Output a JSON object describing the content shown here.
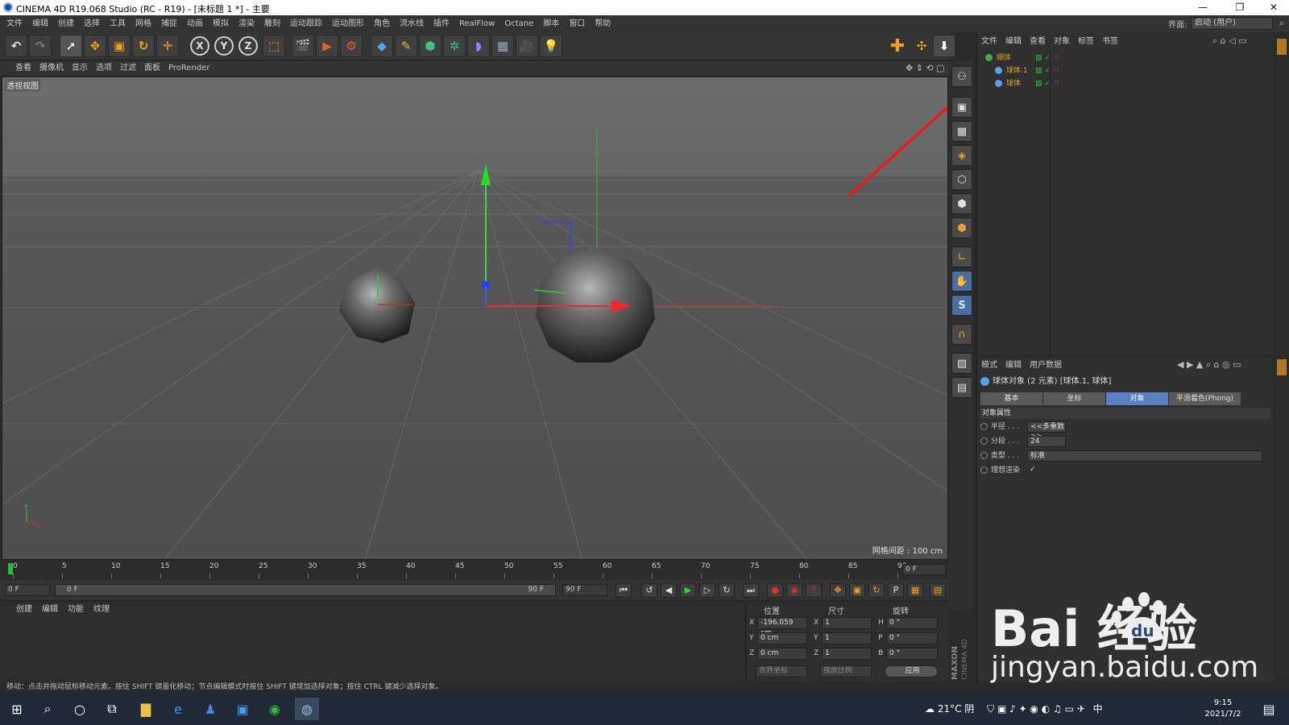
{
  "titlebar": {
    "title": "CINEMA 4D R19.068 Studio (RC - R19) - [未标题 1 *] - 主要",
    "minimize": "—",
    "maximize": "❐",
    "close": "✕"
  },
  "menubar": {
    "items": [
      "文件",
      "编辑",
      "创建",
      "选择",
      "工具",
      "网格",
      "捕捉",
      "动画",
      "模拟",
      "渲染",
      "雕刻",
      "运动跟踪",
      "运动图形",
      "角色",
      "流水线",
      "插件",
      "RealFlow",
      "Octane",
      "脚本",
      "窗口",
      "帮助"
    ],
    "layout_label": "界面:",
    "layout_value": "启动 (用户)"
  },
  "toolbar": {
    "axis_x": "X",
    "axis_y": "Y",
    "axis_z": "Z"
  },
  "viewport": {
    "menu": [
      "查看",
      "摄像机",
      "显示",
      "选项",
      "过滤",
      "面板",
      "ProRender"
    ],
    "label": "透视视图",
    "grid_spacing": "网格间距 : 100 cm"
  },
  "object_manager": {
    "menu": [
      "文件",
      "编辑",
      "查看",
      "对象",
      "标签",
      "书签"
    ],
    "objects": [
      {
        "name": "细体",
        "level": 0,
        "color": "#d3a030"
      },
      {
        "name": "球体.1",
        "level": 1,
        "color": "#d3a030"
      },
      {
        "name": "球体",
        "level": 1,
        "color": "#d3a030"
      }
    ]
  },
  "attribute_manager": {
    "menu": [
      "模式",
      "编辑",
      "用户数据"
    ],
    "header": "球体对象 (2 元素) [球体.1, 球体]",
    "tabs": [
      "基本",
      "坐标",
      "对象",
      "平滑着色(Phong)"
    ],
    "active_tab": "对象",
    "section": "对象属性",
    "props": [
      {
        "label": "半径 . . .",
        "value": "<<多重数>>"
      },
      {
        "label": "分段 . . .",
        "value": "24"
      },
      {
        "label": "类型 . . .",
        "value": "标准"
      },
      {
        "label": "理想渲染",
        "value": "✓"
      }
    ]
  },
  "timeline": {
    "ticks": [
      "0",
      "5",
      "10",
      "15",
      "20",
      "25",
      "30",
      "35",
      "40",
      "45",
      "50",
      "55",
      "60",
      "65",
      "70",
      "75",
      "80",
      "85",
      "90"
    ],
    "current_frame": "0 F",
    "start_frame": "0 F",
    "range_start": "0 F",
    "range_end": "90 F",
    "end_frame": "90 F"
  },
  "material_panel": {
    "menu": [
      "创建",
      "编辑",
      "功能",
      "纹理"
    ]
  },
  "coordinates": {
    "headers": [
      "位置",
      "尺寸",
      "旋转"
    ],
    "rows": [
      {
        "axis": "X",
        "pos": "-196.059 cm",
        "size_axis": "X",
        "size": "1",
        "rot_axis": "H",
        "rot": "0 °"
      },
      {
        "axis": "Y",
        "pos": "0 cm",
        "size_axis": "Y",
        "size": "1",
        "rot_axis": "P",
        "rot": "0 °"
      },
      {
        "axis": "Z",
        "pos": "0 cm",
        "size_axis": "Z",
        "size": "1",
        "rot_axis": "B",
        "rot": "0 °"
      }
    ],
    "mode1": "世界坐标",
    "mode2": "缩放比例",
    "apply": "应用"
  },
  "branding": {
    "maxon": "MAXON",
    "c4d": "CINEMA 4D"
  },
  "statusbar": {
    "text": "移动：点击并拖动鼠标移动元素。按住 SHIFT 键量化移动；节点编辑模式时按住 SHIFT 键增加选择对象；按住 CTRL 键减少选择对象。"
  },
  "taskbar": {
    "weather": "21°C 阴",
    "ime": "中",
    "time": "9:15",
    "date": "2021/7/2"
  },
  "watermark": {
    "brand": "Bai  经验",
    "du": "du",
    "url": "jingyan.baidu.com"
  }
}
